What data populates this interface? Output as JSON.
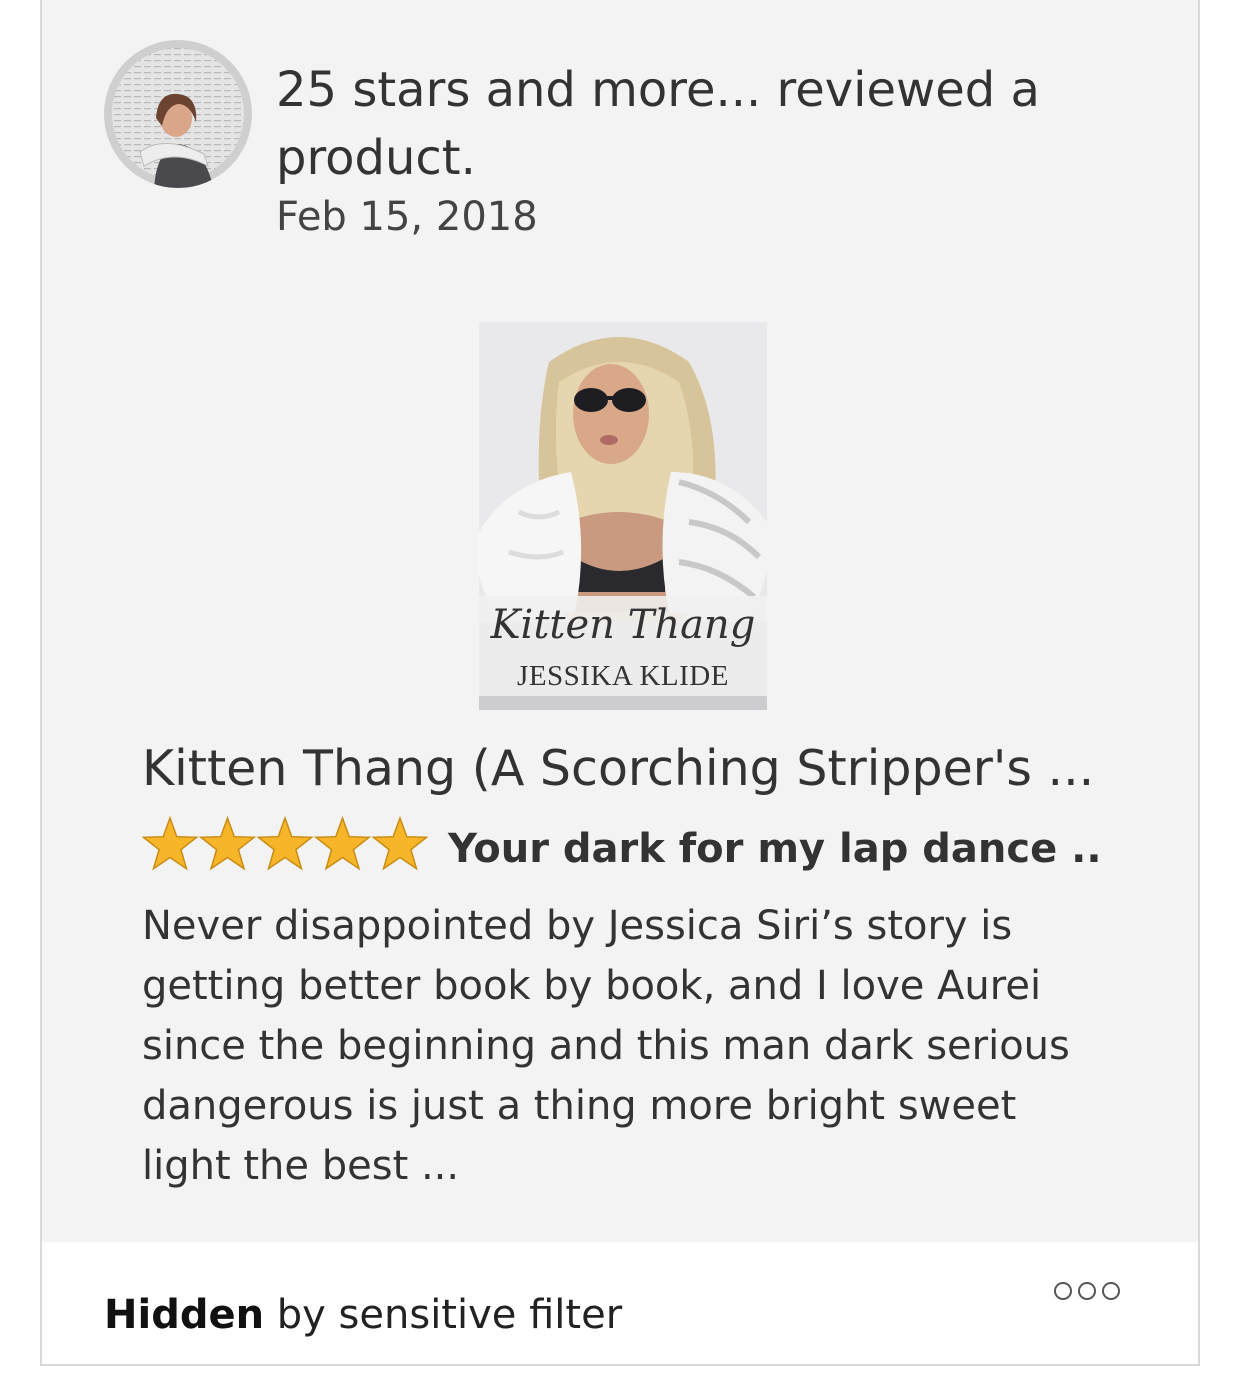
{
  "header": {
    "reviewer_name": "25 stars and more...",
    "action_text": " reviewed a product.",
    "date": "Feb 15, 2018"
  },
  "product": {
    "cover_title": "Kitten Thang",
    "cover_author": "JESSIKA KLIDE",
    "title": "Kitten Thang (A Scorching Stripper's ..."
  },
  "review": {
    "rating": 5,
    "rating_max": 5,
    "title": "Your dark for my lap dance ..",
    "body": "Never disappointed by Jessica Siri’s story is getting better book by book, and I love Aurei since the beginning and this man dark serious dangerous is just a thing more bright sweet light the best ..."
  },
  "footer": {
    "status_bold": "Hidden",
    "status_rest": " by sensitive filter"
  },
  "icons": {
    "avatar": "reviewer-avatar",
    "stars": "star-icon",
    "more": "more-options-icon"
  },
  "colors": {
    "card_background": "#f3f3f3",
    "star_fill": "#f7b52a",
    "star_stroke": "#c88c12"
  }
}
